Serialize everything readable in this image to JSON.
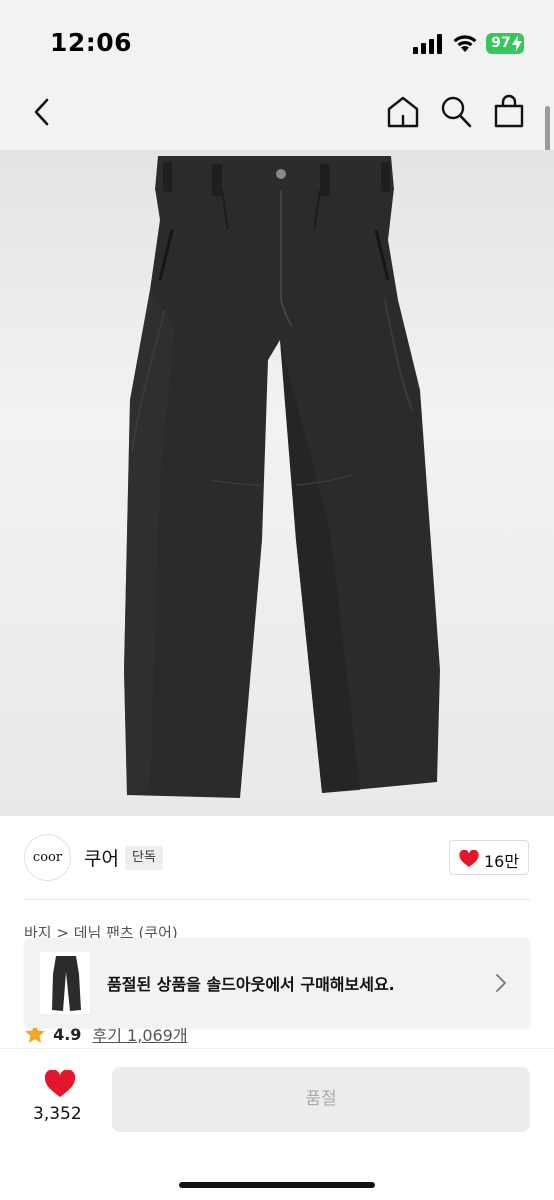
{
  "status_bar": {
    "time": "12:06",
    "battery": "97"
  },
  "nav": {
    "icons": [
      "back-icon",
      "home-icon",
      "search-icon",
      "bag-icon"
    ]
  },
  "brand": {
    "logo_text": "coor",
    "name": "쿠어",
    "badge": "단독",
    "like_count": "16만"
  },
  "breadcrumb": "바지 > 데님 팬츠 (쿠어)",
  "rating": {
    "score": "4.9",
    "review_text": "후기 1,069개"
  },
  "soldout_banner": {
    "text": "품절된 상품을 솔드아웃에서 구매해보세요."
  },
  "bottom_bar": {
    "favorite_count": "3,352",
    "action_label": "품절"
  },
  "colors": {
    "heart": "#e5162b",
    "star": "#f5a623",
    "battery": "#34c759",
    "pants": "#2a2b2d"
  }
}
